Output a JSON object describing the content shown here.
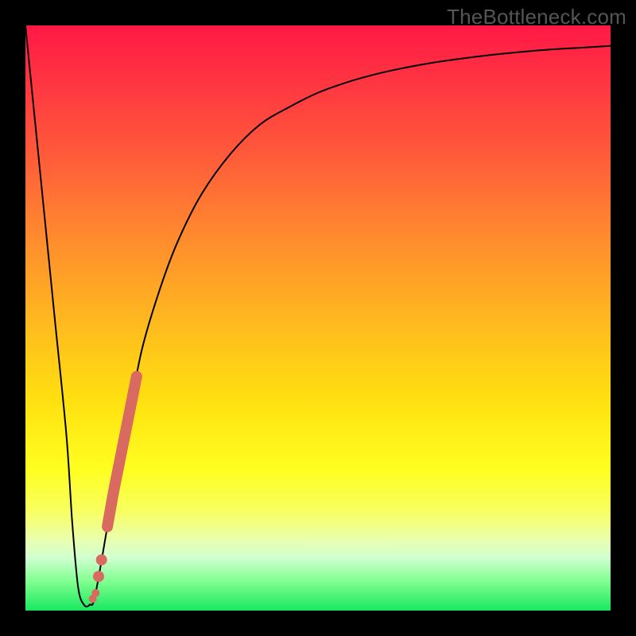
{
  "watermark": "TheBottleneck.com",
  "chart_data": {
    "type": "line",
    "title": "",
    "xlabel": "",
    "ylabel": "",
    "xlim": [
      0,
      100
    ],
    "ylim": [
      0,
      100
    ],
    "series": [
      {
        "name": "curve",
        "x": [
          0,
          3,
          5,
          7,
          8,
          9,
          10,
          11,
          12,
          15,
          18,
          20,
          23,
          26,
          30,
          35,
          40,
          45,
          50,
          55,
          60,
          65,
          70,
          75,
          80,
          85,
          90,
          95,
          100
        ],
        "values": [
          100,
          70,
          50,
          30,
          15,
          4,
          1,
          1,
          3,
          20,
          35,
          45,
          55,
          63,
          71,
          78,
          83,
          86,
          88.5,
          90.3,
          91.7,
          92.8,
          93.7,
          94.4,
          95.0,
          95.5,
          95.9,
          96.2,
          96.5
        ]
      }
    ],
    "markers": [
      {
        "x_range": [
          14,
          19
        ],
        "shape": "thick-segment"
      },
      {
        "x": 13.0,
        "shape": "dot"
      },
      {
        "x": 12.5,
        "shape": "dot"
      },
      {
        "x": 12.0,
        "shape": "dot-small"
      },
      {
        "x": 11.5,
        "shape": "dot-small"
      }
    ],
    "gradient_stops": [
      {
        "pos": 0.0,
        "color": "#ff1846"
      },
      {
        "pos": 0.5,
        "color": "#ffb720"
      },
      {
        "pos": 0.76,
        "color": "#ffff20"
      },
      {
        "pos": 1.0,
        "color": "#18e860"
      }
    ]
  }
}
